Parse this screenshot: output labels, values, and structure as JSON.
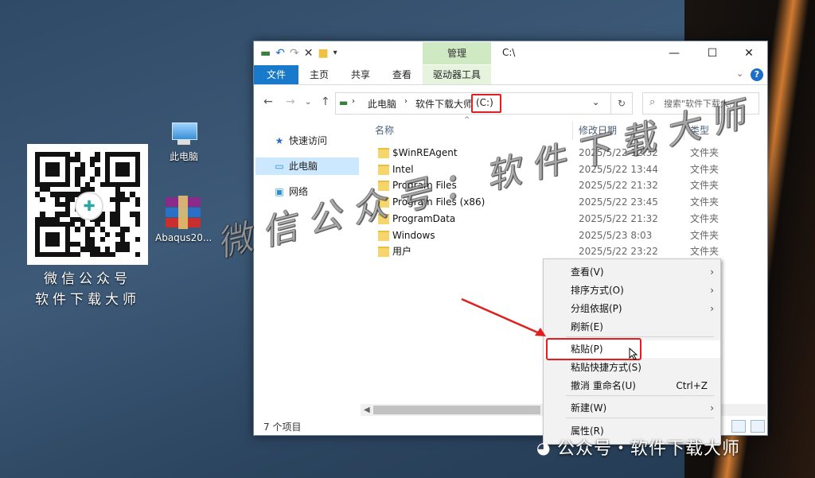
{
  "desktop": {
    "qr_caption_line1": "微信公众号",
    "qr_caption_line2": "软件下载大师",
    "icons": [
      {
        "label": "此电脑"
      },
      {
        "label": "Abaqus20..."
      }
    ]
  },
  "explorer": {
    "window_title": "C:\\",
    "context_tab_header": "管理",
    "ribbon_tabs": [
      "文件",
      "主页",
      "共享",
      "查看",
      "驱动器工具"
    ],
    "address": {
      "segments": [
        "此电脑",
        "软件下载大师",
        "(C:)"
      ]
    },
    "search_placeholder": "搜索\"软件下载大...",
    "nav_pane": [
      {
        "label": "快速访问",
        "selected": false
      },
      {
        "label": "此电脑",
        "selected": true
      },
      {
        "label": "网络",
        "selected": false
      }
    ],
    "columns": {
      "name": "名称",
      "date": "修改日期",
      "type": "类型"
    },
    "files": [
      {
        "name": "$WinREAgent",
        "date": "2025/5/22 12:32",
        "type": "文件夹"
      },
      {
        "name": "Intel",
        "date": "2025/5/22 13:44",
        "type": "文件夹"
      },
      {
        "name": "Program Files",
        "date": "2025/5/22 21:32",
        "type": "文件夹"
      },
      {
        "name": "Program Files (x86)",
        "date": "2025/5/22 23:45",
        "type": "文件夹"
      },
      {
        "name": "ProgramData",
        "date": "2025/5/22 21:32",
        "type": "文件夹"
      },
      {
        "name": "Windows",
        "date": "2025/5/23 8:03",
        "type": "文件夹"
      },
      {
        "name": "用户",
        "date": "2025/5/22 23:22",
        "type": "文件夹"
      }
    ],
    "status_text": "7 个项目"
  },
  "context_menu": {
    "items": [
      {
        "label": "查看(V)",
        "submenu": true,
        "shortcut": ""
      },
      {
        "label": "排序方式(O)",
        "submenu": true,
        "shortcut": ""
      },
      {
        "label": "分组依据(P)",
        "submenu": true,
        "shortcut": ""
      },
      {
        "label": "刷新(E)",
        "submenu": false,
        "shortcut": ""
      },
      {
        "label": "粘贴(P)",
        "submenu": false,
        "shortcut": ""
      },
      {
        "label": "粘贴快捷方式(S)",
        "submenu": false,
        "shortcut": ""
      },
      {
        "label": "撤消 重命名(U)",
        "submenu": false,
        "shortcut": "Ctrl+Z"
      },
      {
        "label": "新建(W)",
        "submenu": true,
        "shortcut": ""
      },
      {
        "label": "属性(R)",
        "submenu": false,
        "shortcut": ""
      }
    ]
  },
  "watermark": {
    "main": "微信公众号：软件下载大师",
    "footer": "公众号・软件下载大师"
  },
  "colors": {
    "accent": "#1979ca",
    "highlight": "#e02020",
    "context_tab": "#cfe9c2"
  }
}
